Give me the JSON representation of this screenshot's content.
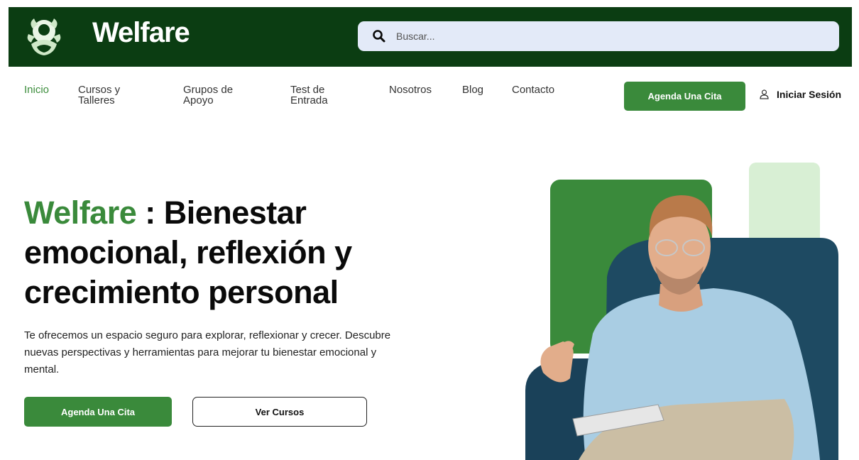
{
  "header": {
    "logo_text": "Welfare",
    "search_placeholder": "Buscar..."
  },
  "nav": {
    "items": [
      {
        "label": "Inicio",
        "active": true
      },
      {
        "label": "Cursos y\nTalleres"
      },
      {
        "label": "Grupos de\nApoyo"
      },
      {
        "label": "Test de\nEntrada"
      },
      {
        "label": "Nosotros"
      },
      {
        "label": "Blog"
      },
      {
        "label": "Contacto"
      }
    ],
    "cta_label": "Agenda Una Cita",
    "login_label": "Iniciar Sesión"
  },
  "hero": {
    "title_brand": "Welfare",
    "title_rest": " : Bienestar emocional, reflexión y crecimiento personal",
    "description": "Te ofrecemos un espacio seguro para explorar, reflexionar y crecer. Descubre nuevas perspectivas y herramientas para mejorar tu bienestar emocional y mental.",
    "primary_button": "Agenda Una Cita",
    "secondary_button": "Ver Cursos"
  },
  "colors": {
    "header_bg": "#0b3d12",
    "accent": "#3a8a3b",
    "search_bg": "#e3eaf8"
  }
}
